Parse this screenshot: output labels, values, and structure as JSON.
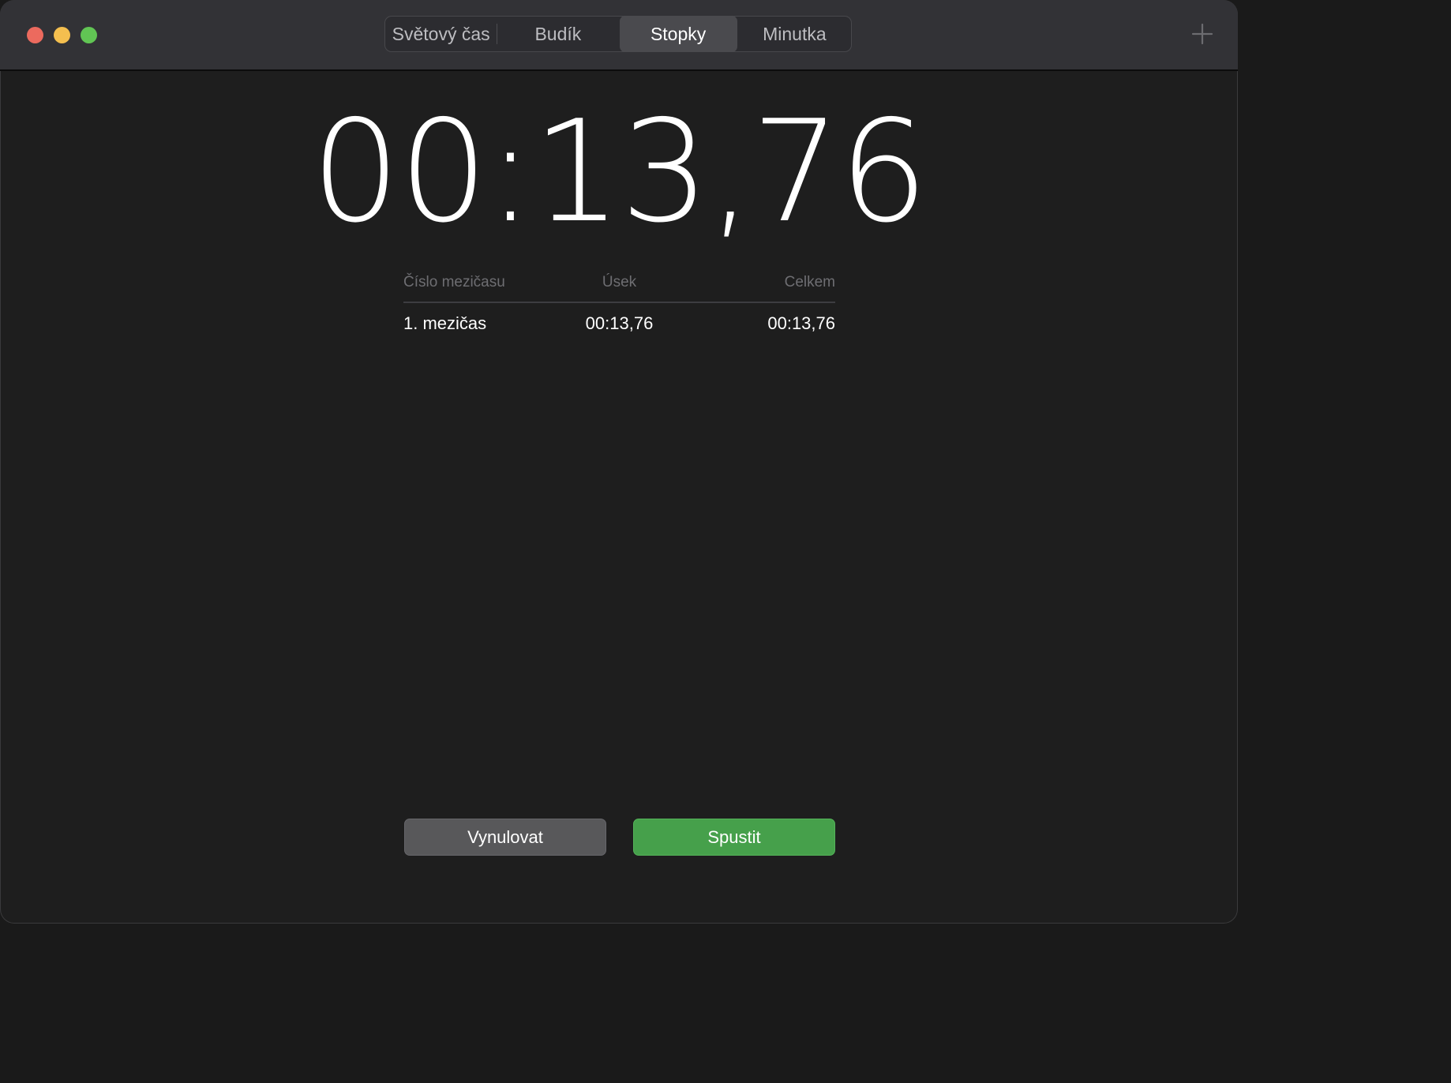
{
  "window": {
    "controls": [
      "close",
      "minimize",
      "zoom"
    ],
    "add_button_icon": "plus-icon"
  },
  "tabs": [
    {
      "label": "Světový čas",
      "active": false
    },
    {
      "label": "Budík",
      "active": false
    },
    {
      "label": "Stopky",
      "active": true
    },
    {
      "label": "Minutka",
      "active": false
    }
  ],
  "stopwatch": {
    "display": "00:13,76"
  },
  "laps": {
    "headers": {
      "number": "Číslo mezičasu",
      "split": "Úsek",
      "total": "Celkem"
    },
    "rows": [
      {
        "number": "1. mezičas",
        "split": "00:13,76",
        "total": "00:13,76"
      }
    ]
  },
  "buttons": {
    "reset": "Vynulovat",
    "start": "Spustit"
  },
  "colors": {
    "close": "#ec6a5e",
    "minimize": "#f4bf4f",
    "zoom": "#61c554",
    "start_button": "#46a04b",
    "reset_button": "#58585a"
  }
}
